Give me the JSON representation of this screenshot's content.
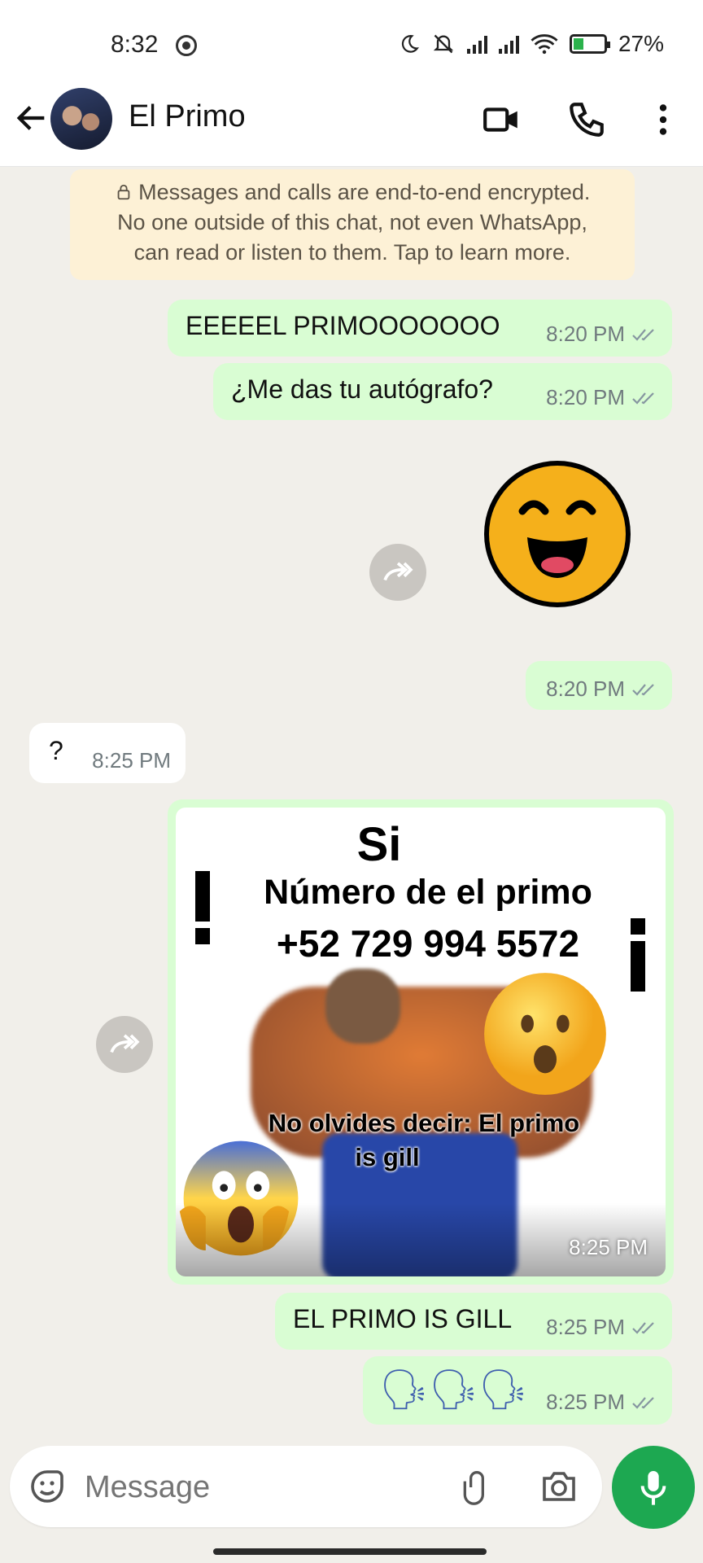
{
  "status_bar": {
    "time": "8:32",
    "battery": "27%"
  },
  "header": {
    "contact_name": "El Primo"
  },
  "notice": {
    "lines": [
      "Messages and calls are end-to-end encrypted.",
      "No one outside of this chat, not even WhatsApp,",
      "can read or listen to them. Tap to learn more."
    ]
  },
  "messages": [
    {
      "direction": "out",
      "text": "EEEEEL PRIMOOOOOOO",
      "time": "8:20 PM"
    },
    {
      "direction": "out",
      "text": "¿Me das tu autógrafo?",
      "time": "8:20 PM"
    },
    {
      "direction": "out",
      "type": "sticker",
      "icon": "laughing-face-sticker",
      "time": "8:20 PM"
    },
    {
      "direction": "in",
      "text": "?",
      "time": "8:25 PM"
    },
    {
      "direction": "out",
      "type": "image",
      "time": "8:25 PM",
      "image_text": {
        "top": "Si",
        "line1": "Número de el primo",
        "line2": "+52 729 994 5572",
        "bottom1": "No olvides decir: El primo",
        "bottom2": "is gill"
      }
    },
    {
      "direction": "out",
      "text": "EL PRIMO IS GILL",
      "time": "8:25 PM"
    },
    {
      "direction": "out",
      "type": "emoji",
      "text": "🗣🗣🗣",
      "time": "8:25 PM"
    }
  ],
  "composer": {
    "placeholder": "Message"
  },
  "colors": {
    "outgoing": "#d9fdd3",
    "incoming": "#ffffff",
    "chat_bg": "#f1efea",
    "accent": "#1da851",
    "notice_bg": "#fdf1d6"
  }
}
